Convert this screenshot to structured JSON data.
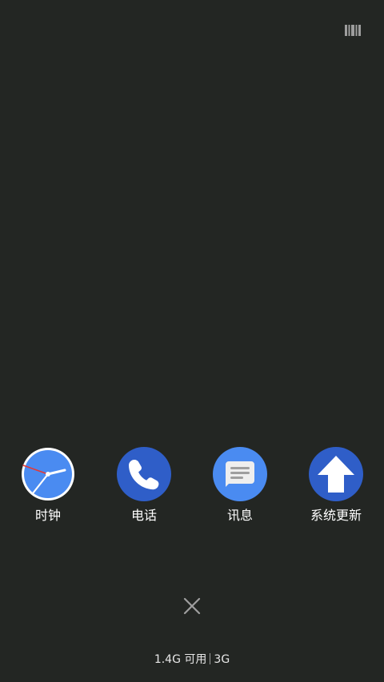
{
  "top_bar": {
    "icon": "barcode-icon"
  },
  "apps": [
    {
      "label": "时钟",
      "icon": "clock-icon"
    },
    {
      "label": "电话",
      "icon": "phone-icon"
    },
    {
      "label": "讯息",
      "icon": "message-icon"
    },
    {
      "label": "系统更新",
      "icon": "system-update-icon"
    }
  ],
  "close_icon": "close-icon",
  "memory_status": {
    "available": "1.4G 可用",
    "total": "3G"
  },
  "colors": {
    "background": "#232623",
    "clock_face": "#4a8bf1",
    "phone_bg": "#2f5ec8",
    "message_bg": "#4a8bf1",
    "update_bg": "#2f5ec8"
  }
}
